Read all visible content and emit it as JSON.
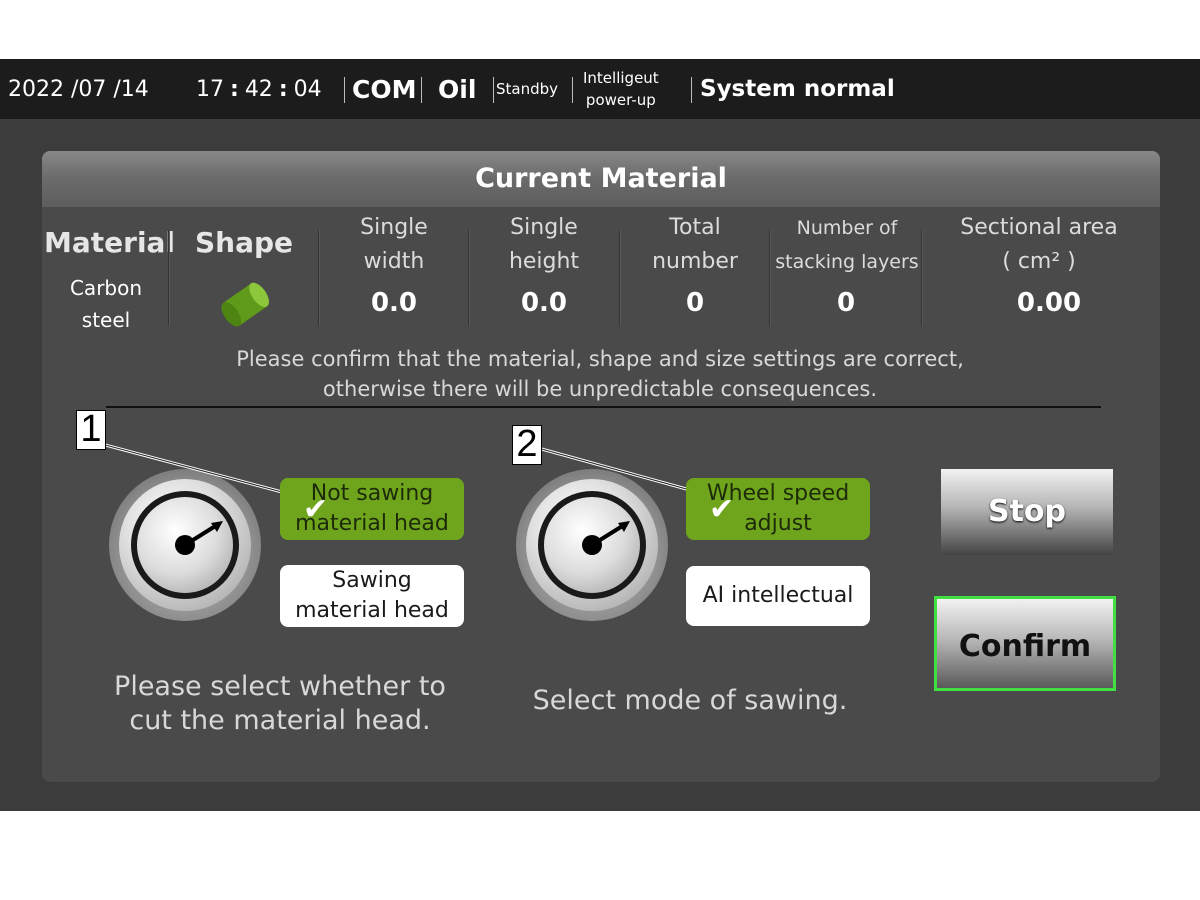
{
  "statusbar": {
    "date": "2022  /07 /14",
    "hour": "17",
    "minute": "42",
    "second": "04",
    "com": "COM",
    "oil": "Oil",
    "standby": "Standby",
    "power_line1": "Intelligeut",
    "power_line2": "power-up",
    "system": "System normal"
  },
  "panel": {
    "title": "Current Material",
    "columns": {
      "material_label": "Material",
      "material_value_line1": "Carbon",
      "material_value_line2": "steel",
      "shape_label": "Shape",
      "width_label_1": "Single",
      "width_label_2": "width",
      "width_value": "0.0",
      "height_label_1": "Single",
      "height_label_2": "height",
      "height_value": "0.0",
      "total_label_1": "Total",
      "total_label_2": "number",
      "total_value": "0",
      "layers_label_1": "Number of",
      "layers_label_2": "stacking layers",
      "layers_value": "0",
      "area_label_1": "Sectional area",
      "area_label_2": "( cm² )",
      "area_value": "0.00"
    },
    "warning_line1": "Please confirm that the material, shape and size settings are correct,",
    "warning_line2": "otherwise there will be unpredictable consequences."
  },
  "head_options": {
    "option1_line1": "Not sawing",
    "option1_line2": "material head",
    "option2_line1": "Sawing",
    "option2_line2": "material head",
    "caption_line1": "Please select whether to",
    "caption_line2": "cut the material head."
  },
  "mode_options": {
    "option1_line1": "Wheel speed",
    "option1_line2": "adjust",
    "option2": "AI intellectual",
    "caption": "Select mode of sawing."
  },
  "buttons": {
    "stop": "Stop",
    "confirm": "Confirm"
  },
  "callouts": {
    "one": "1",
    "two": "2"
  },
  "colors": {
    "selected_option": "#6fa51d",
    "confirm_border": "#3fe03f"
  }
}
